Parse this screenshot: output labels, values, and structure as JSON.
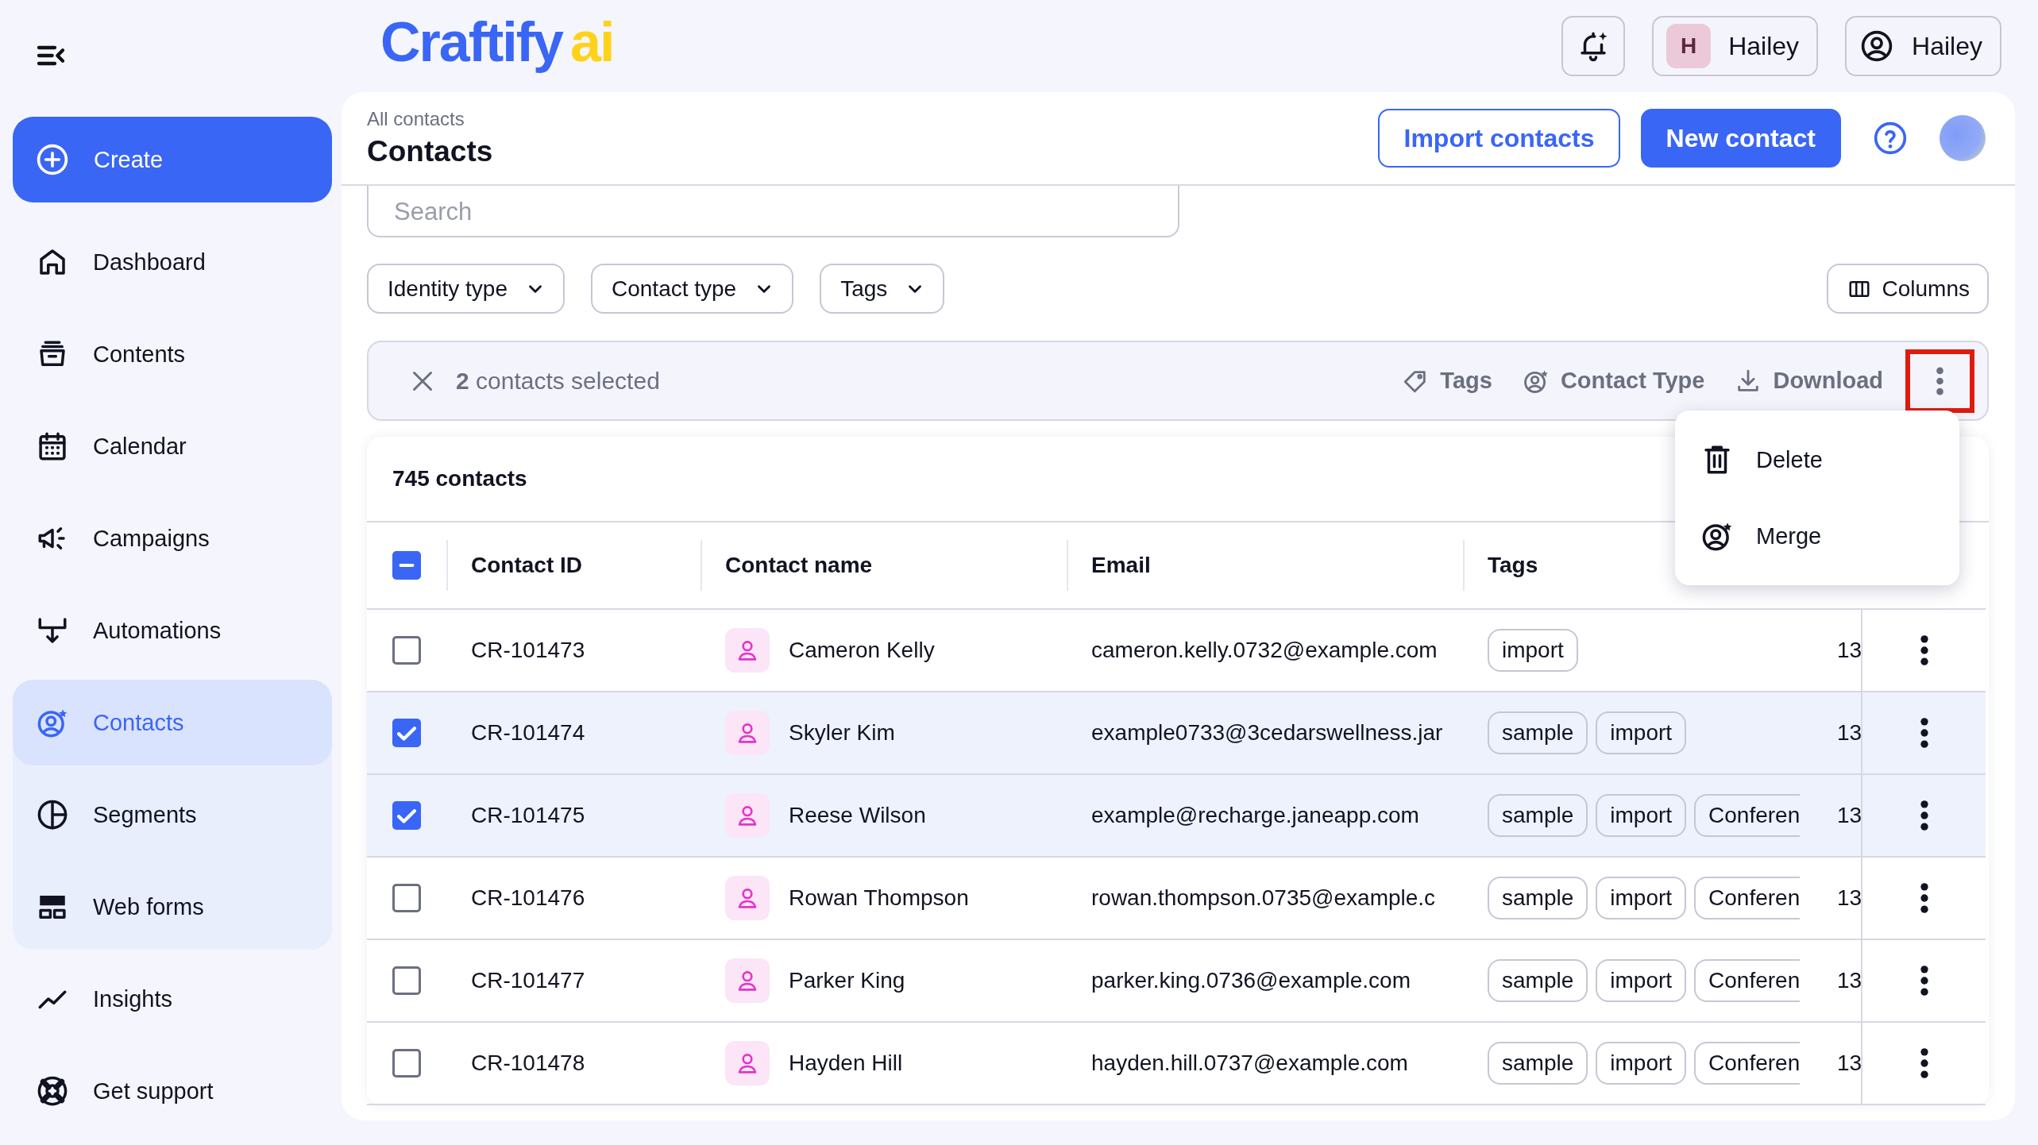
{
  "sidebar": {
    "create_button": "Create",
    "items": [
      {
        "label": "Dashboard",
        "selected": false
      },
      {
        "label": "Contents",
        "selected": false
      },
      {
        "label": "Calendar",
        "selected": false
      },
      {
        "label": "Campaigns",
        "selected": false
      },
      {
        "label": "Automations",
        "selected": false
      },
      {
        "label": "Contacts",
        "selected": true,
        "expanded": true,
        "children": [
          {
            "label": "Segments",
            "selected": false
          },
          {
            "label": "Web forms",
            "selected": false
          }
        ]
      },
      {
        "label": "Insights",
        "selected": false
      },
      {
        "label": "Get support",
        "selected": false
      }
    ]
  },
  "topbar": {
    "logo": {
      "name": "Craftify",
      "suffix": "ai"
    },
    "workspace": {
      "initial": "H",
      "name": "Hailey"
    },
    "account": {
      "name": "Hailey"
    }
  },
  "header": {
    "breadcrumb": "All contacts",
    "title": "Contacts",
    "buttons": [
      {
        "label": "Import contacts",
        "kind": "outline"
      },
      {
        "label": "New contact",
        "kind": "primary"
      }
    ]
  },
  "search": {
    "placeholder": "Search"
  },
  "filters": [
    "Identity type",
    "Contact type",
    "Tags"
  ],
  "columns_button": "Columns",
  "selection_bar": {
    "label": "**2** contacts selected",
    "actions": [
      "Tags",
      "Contact Type",
      "Download"
    ],
    "more_button": {
      "highlighted": true
    }
  },
  "menu": {
    "items": [
      "Delete",
      "Merge"
    ]
  },
  "table": {
    "count": "745 contacts",
    "select_all_indeterminate": true,
    "columns": [
      "Contact ID",
      "Contact name",
      "Email",
      "Tags"
    ],
    "rows": [
      {
        "selected": false,
        "contact_id": "CR-101473",
        "name": "Cameron Kelly",
        "email": "cameron.kelly.0732@example.com",
        "tags": [
          "import"
        ],
        "tags_cut": false,
        "column_5": "13"
      },
      {
        "selected": true,
        "contact_id": "CR-101474",
        "name": "Skyler Kim",
        "email": "example0733@3cedarswellness.jar",
        "tags": [
          "sample",
          "import"
        ],
        "tags_cut": false,
        "column_5": "13"
      },
      {
        "selected": true,
        "contact_id": "CR-101475",
        "name": "Reese Wilson",
        "email": "example@recharge.janeapp.com",
        "tags": [
          "sample",
          "import",
          "Conferen"
        ],
        "tags_cut": true,
        "column_5": "13"
      },
      {
        "selected": false,
        "contact_id": "CR-101476",
        "name": "Rowan Thompson",
        "email": "rowan.thompson.0735@example.c",
        "tags": [
          "sample",
          "import",
          "Conferen"
        ],
        "tags_cut": true,
        "column_5": "13"
      },
      {
        "selected": false,
        "contact_id": "CR-101477",
        "name": "Parker King",
        "email": "parker.king.0736@example.com",
        "tags": [
          "sample",
          "import",
          "Conferen"
        ],
        "tags_cut": true,
        "column_5": "13"
      },
      {
        "selected": false,
        "contact_id": "CR-101478",
        "name": "Hayden Hill",
        "email": "hayden.hill.0737@example.com",
        "tags": [
          "sample",
          "import",
          "Conferen"
        ],
        "tags_cut": true,
        "column_5": "13"
      }
    ]
  }
}
